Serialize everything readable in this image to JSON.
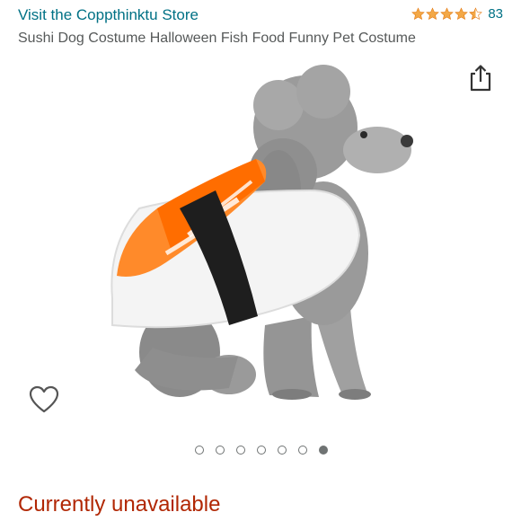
{
  "store": {
    "link_label": "Visit the Coppthinktu Store"
  },
  "rating": {
    "stars": 4.5,
    "count": "83",
    "star_color": "#f3a847"
  },
  "product": {
    "title": "Sushi Dog Costume Halloween Fish Food Funny Pet Costume"
  },
  "icons": {
    "share": "share-icon",
    "wishlist": "heart-icon"
  },
  "carousel": {
    "total": 7,
    "active_index": 6
  },
  "availability": {
    "text": "Currently unavailable",
    "color": "#b12704"
  }
}
